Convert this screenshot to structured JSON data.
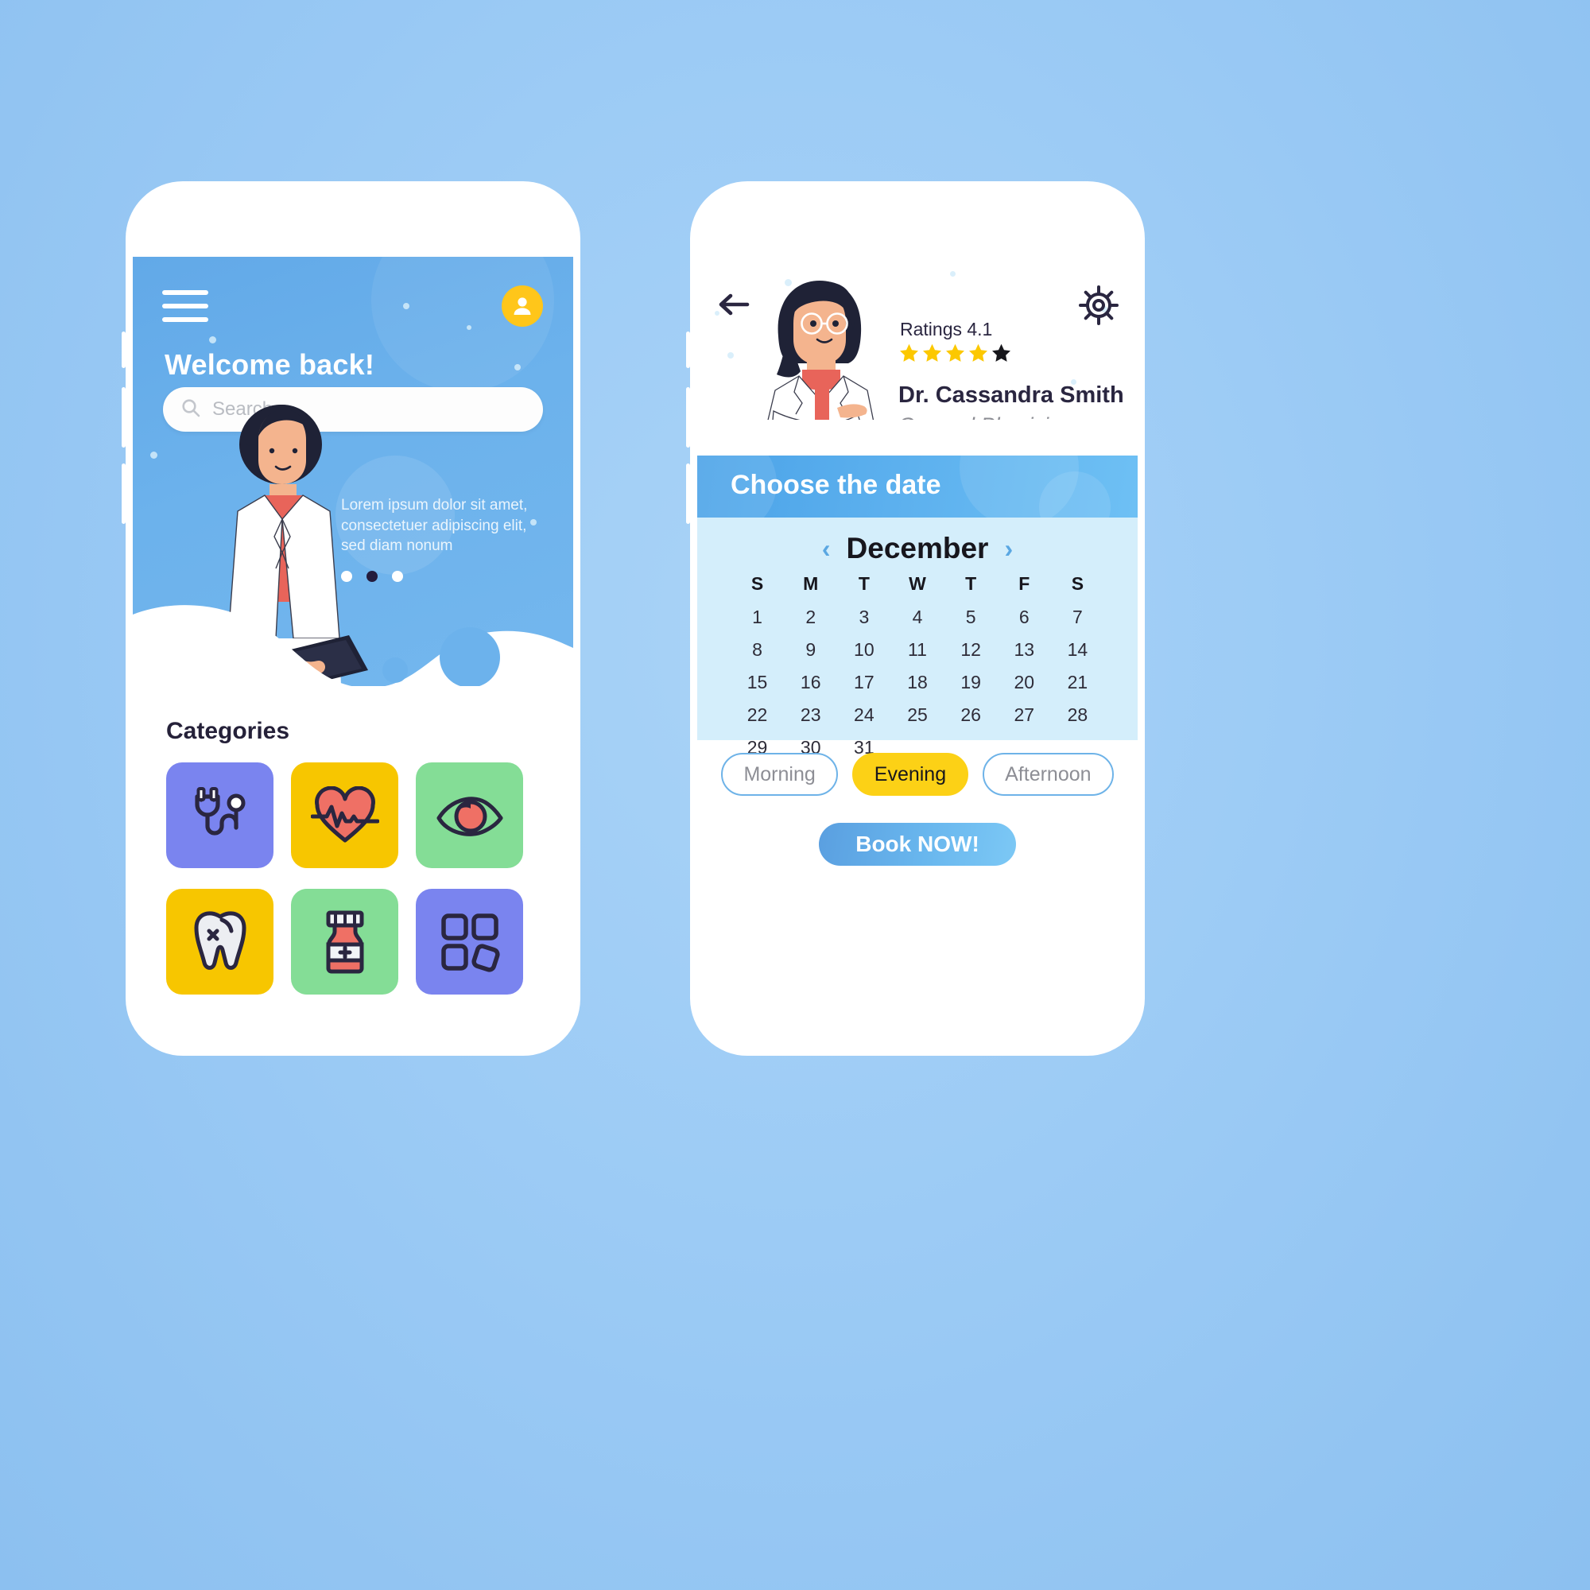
{
  "theme": {
    "page_bg": "#9ccbf5",
    "primary_blue": "#62a9e8",
    "accent_yellow": "#fcd116",
    "dark_navy": "#2a2640",
    "calendar_bg": "#d4eefb"
  },
  "screen1": {
    "menu_icon": "hamburger-menu-icon",
    "avatar_icon": "user-avatar-icon",
    "welcome_title": "Welcome back!",
    "search": {
      "placeholder": "Search",
      "icon": "search-icon",
      "value": ""
    },
    "hero_text": "Lorem ipsum dolor sit amet, consectetuer adipiscing elit, sed diam nonum",
    "carousel": {
      "total": 3,
      "active_index": 1
    },
    "categories_title": "Categories",
    "categories": [
      {
        "name": "stethoscope",
        "label": "Stethoscope",
        "bg": "#7a84ef"
      },
      {
        "name": "heartbeat",
        "label": "Cardiology",
        "bg": "#f7c600"
      },
      {
        "name": "eye",
        "label": "Ophthalmology",
        "bg": "#84dd96"
      },
      {
        "name": "tooth",
        "label": "Dental",
        "bg": "#f7c600"
      },
      {
        "name": "medicine",
        "label": "Pharmacy",
        "bg": "#84dd96"
      },
      {
        "name": "grid",
        "label": "More",
        "bg": "#7a84ef"
      }
    ]
  },
  "screen2": {
    "back_icon": "back-arrow-icon",
    "settings_icon": "gear-icon",
    "doctor": {
      "ratings_label": "Ratings 4.1",
      "rating_value": 4.1,
      "stars_filled": 4,
      "stars_total": 5,
      "name": "Dr. Cassandra Smith",
      "specialty": "General Physician"
    },
    "choose_date_title": "Choose the date",
    "calendar": {
      "month": "December",
      "prev_icon": "chevron-left-icon",
      "next_icon": "chevron-right-icon",
      "day_headers": [
        "S",
        "M",
        "T",
        "W",
        "T",
        "F",
        "S"
      ],
      "leading_blanks": 0,
      "days": [
        1,
        2,
        3,
        4,
        5,
        6,
        7,
        8,
        9,
        10,
        11,
        12,
        13,
        14,
        15,
        16,
        17,
        18,
        19,
        20,
        21,
        22,
        23,
        24,
        25,
        26,
        27,
        28,
        29,
        30,
        31
      ],
      "selected_day": 12
    },
    "time_slots": [
      {
        "label": "Morning",
        "selected": false
      },
      {
        "label": "Evening",
        "selected": true
      },
      {
        "label": "Afternoon",
        "selected": false
      }
    ],
    "book_button": "Book NOW!"
  }
}
